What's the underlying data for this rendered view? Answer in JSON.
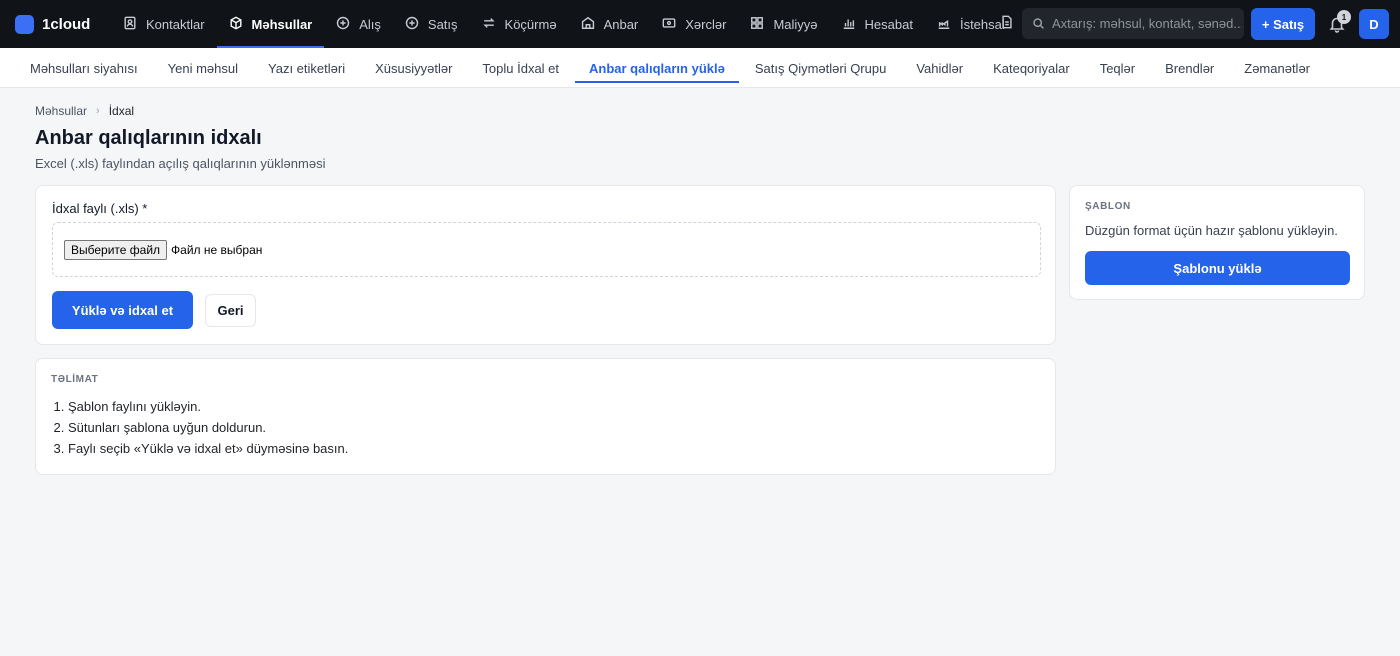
{
  "brand": {
    "name": "1cloud"
  },
  "nav": {
    "items": [
      {
        "label": "Kontaktlar",
        "icon": "contacts-icon"
      },
      {
        "label": "Məhsullar",
        "icon": "box-icon",
        "active": true
      },
      {
        "label": "Alış",
        "icon": "plus-circle-icon"
      },
      {
        "label": "Satış",
        "icon": "plus-circle-icon"
      },
      {
        "label": "Köçürmə",
        "icon": "transfer-icon"
      },
      {
        "label": "Anbar",
        "icon": "warehouse-icon"
      },
      {
        "label": "Xərclər",
        "icon": "wallet-icon"
      },
      {
        "label": "Maliyyə",
        "icon": "grid-icon"
      },
      {
        "label": "Hesabat",
        "icon": "bar-chart-icon"
      },
      {
        "label": "İstehsal",
        "icon": "factory-icon"
      }
    ]
  },
  "search": {
    "placeholder": "Axtarış: məhsul, kontakt, sənəd..."
  },
  "header_actions": {
    "new_sale_label": "+ Satış",
    "notifications_count": "1",
    "avatar_initial": "D"
  },
  "subnav": {
    "items": [
      {
        "label": "Məhsulları siyahısı"
      },
      {
        "label": "Yeni məhsul"
      },
      {
        "label": "Yazı etiketləri"
      },
      {
        "label": "Xüsusiyyətlər"
      },
      {
        "label": "Toplu İdxal et"
      },
      {
        "label": "Anbar qalıqların yüklə",
        "active": true
      },
      {
        "label": "Satış Qiymətləri Qrupu"
      },
      {
        "label": "Vahidlər"
      },
      {
        "label": "Kateqoriyalar"
      },
      {
        "label": "Teqlər"
      },
      {
        "label": "Brendlər"
      },
      {
        "label": "Zəmanətlər"
      }
    ]
  },
  "breadcrumb": {
    "parent": "Məhsullar",
    "current": "İdxal"
  },
  "page": {
    "title": "Anbar qalıqlarının idxalı",
    "subtitle": "Excel (.xls) faylından açılış qalıqlarının yüklənməsi"
  },
  "upload": {
    "field_label": "İdxal faylı (.xls) *",
    "file_button": "Выберите файл",
    "file_status": "Файл не выбран",
    "submit_label": "Yüklə və idxal et",
    "back_label": "Geri"
  },
  "template": {
    "section_label": "ŞABLON",
    "description": "Düzgün format üçün hazır şablonu yükləyin.",
    "button_label": "Şablonu yüklə"
  },
  "instructions": {
    "section_label": "TƏLİMAT",
    "steps": [
      "Şablon faylını yükləyin.",
      "Sütunları şablona uyğun doldurun.",
      "Faylı seçib «Yüklə və idxal et» düyməsinə basın."
    ]
  }
}
